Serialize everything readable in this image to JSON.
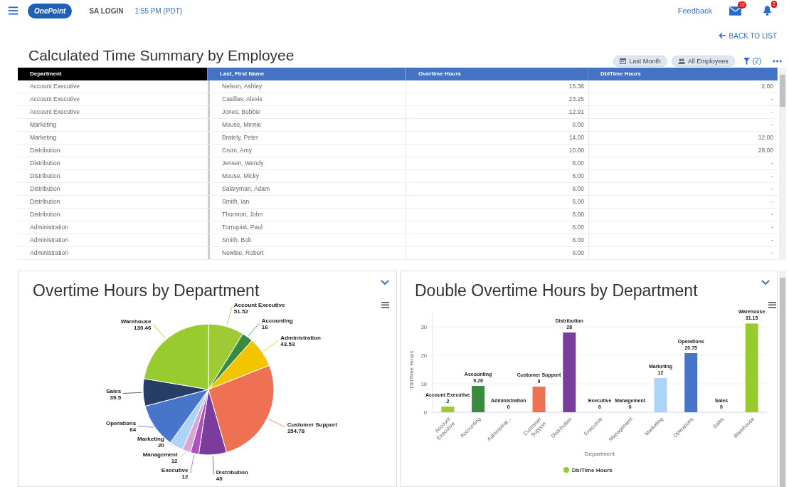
{
  "top_bar": {
    "logo": "OnePoint",
    "login": "SA LOGIN",
    "time": "1:55 PM (PDT)",
    "feedback": "Feedback",
    "mail_count": "12",
    "alert_count": "2"
  },
  "back_link": "BACK TO LIST",
  "report": {
    "title": "Calculated Time Summary by Employee",
    "filters": [
      {
        "kind": "date",
        "label": "Last Month"
      },
      {
        "kind": "people",
        "label": "All Employees"
      }
    ],
    "filter_count": "(2)"
  },
  "table": {
    "columns": [
      {
        "label": "Department",
        "kind": "text",
        "selected": true
      },
      {
        "label": "Last, First Name",
        "kind": "text",
        "selected": false
      },
      {
        "label": "Overtime Hours",
        "kind": "number",
        "selected": false
      },
      {
        "label": "DblTime Hours",
        "kind": "number",
        "selected": false
      }
    ],
    "rows": [
      [
        "Account Executive",
        "Nelson, Ashley",
        "15.36",
        "2.00"
      ],
      [
        "Account Executive",
        "Casillas, Alexis",
        "23.25",
        "-"
      ],
      [
        "Account Executive",
        "Jones, Bobbie",
        "12.91",
        "-"
      ],
      [
        "Marketing",
        "Mouse, Minnie",
        "6.00",
        "-"
      ],
      [
        "Marketing",
        "Brately, Peter",
        "14.00",
        "12.00"
      ],
      [
        "Distribution",
        "Crum, Amy",
        "10.00",
        "28.00"
      ],
      [
        "Distribution",
        "Jensen, Wendy",
        "6.00",
        "-"
      ],
      [
        "Distribution",
        "Mouse, Micky",
        "6.00",
        "-"
      ],
      [
        "Distribution",
        "Salaryman, Adam",
        "6.00",
        "-"
      ],
      [
        "Distribution",
        "Smith, Ian",
        "6.00",
        "-"
      ],
      [
        "Distribution",
        "Thurmon, John",
        "6.00",
        "-"
      ],
      [
        "Administration",
        "Turnquist, Paul",
        "6.00",
        "-"
      ],
      [
        "Administration",
        "Smith, Bob",
        "6.00",
        "-"
      ],
      [
        "Administration",
        "Newbie, Robert",
        "6.00",
        "-"
      ]
    ]
  },
  "overtime_chart": {
    "title": "Overtime Hours by Department",
    "chart_data": {
      "type": "pie",
      "categories": [
        "Account Executive",
        "Accounting",
        "Administration",
        "Customer Support",
        "Distribution",
        "Executive",
        "Management",
        "Marketing",
        "Operations",
        "Sales",
        "Warehouse"
      ],
      "series": [
        {
          "values": [
            51.52,
            16,
            43.53,
            154.78,
            40,
            12,
            12,
            20,
            64,
            39.5,
            130.46
          ]
        }
      ],
      "colors": [
        "#9dca35",
        "#3a8a3f",
        "#f2c500",
        "#ef7153",
        "#7a3d9e",
        "#b04fc2",
        "#d9a6d3",
        "#add4f6",
        "#4775c9",
        "#263e66",
        "#98cb2e"
      ],
      "data_labels": true
    }
  },
  "double_overtime_chart": {
    "title": "Double Overtime Hours by Department",
    "legend": {
      "color": "#98cb2e"
    },
    "chart_data": {
      "type": "bar",
      "xlabel": "Department",
      "ylabel": "DblTime Hours",
      "categories": [
        "Account Executive",
        "Accounting",
        "Administrat...",
        "Customer Support",
        "Distribution",
        "Executive",
        "Management",
        "Marketing",
        "Operations",
        "Sales",
        "Warehouse"
      ],
      "annotations": [
        "Account Executive",
        "Accounting",
        "Administration",
        "Customer Support",
        "Distribution",
        "Executive",
        "Management",
        "Marketing",
        "Operations",
        "Sales",
        "Warehouse"
      ],
      "series": [
        {
          "name": "DblTime Hours",
          "values": [
            2,
            9.26,
            0,
            9,
            28,
            0,
            0,
            12,
            20.75,
            0,
            31.15
          ]
        }
      ],
      "colors": [
        "#9dca35",
        "#3a8a3f",
        "#f2c500",
        "#ef7153",
        "#7a3d9e",
        "#b04fc2",
        "#d9a6d3",
        "#add4f6",
        "#4775c9",
        "#263e66",
        "#98cb2e"
      ],
      "ylim": [
        0,
        35
      ],
      "yticks": [
        0,
        10,
        20,
        30
      ],
      "grid": true,
      "data_labels": true
    }
  }
}
